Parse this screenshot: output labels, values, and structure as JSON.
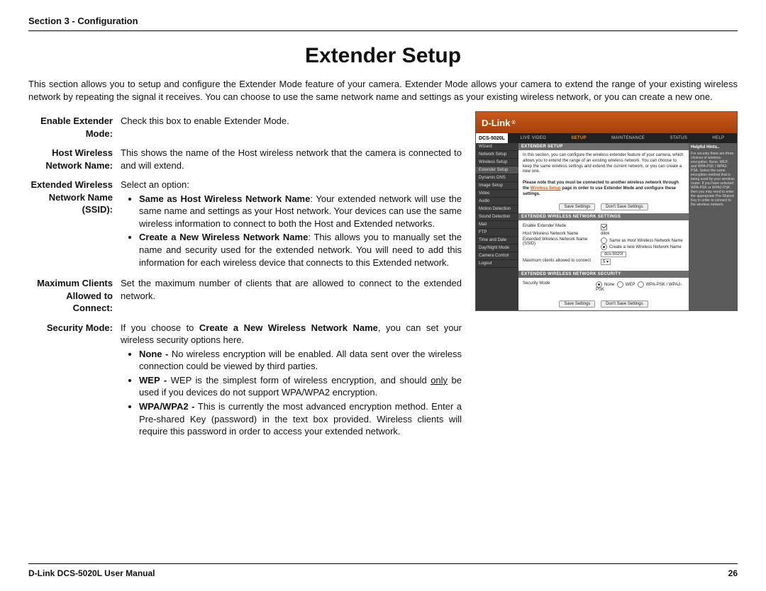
{
  "header": {
    "section_label": "Section 3 - Configuration"
  },
  "title": "Extender Setup",
  "intro": "This section allows you to setup and configure the Extender Mode feature of your camera. Extender Mode allows your camera to extend the range of your existing wireless network by repeating the signal it receives. You can choose to use the same network name and settings as your existing wireless network, or you can create a new one.",
  "defs": {
    "enable": {
      "label": "Enable Extender Mode:",
      "desc": "Check this box to enable Extender Mode."
    },
    "host": {
      "label": "Host Wireless Network Name:",
      "desc": "This shows the name of the Host wireless network that the camera is connected to and will extend."
    },
    "ssid": {
      "label": "Extended Wireless Network Name (SSID):",
      "lead": "Select an option:",
      "opt1_bold": "Same as Host Wireless Network Name",
      "opt1_rest": ": Your extended network will use the same name and settings as your Host network. Your devices can use the same wireless information to connect to both the Host and Extended networks.",
      "opt2_bold": "Create a New Wireless Network Name",
      "opt2_rest": ": This allows you to manually set the name and security used for the extended network. You will need to add this information for each wireless device that connects to this Extended network."
    },
    "max": {
      "label": "Maximum Clients Allowed to Connect:",
      "desc": "Set the maximum number of clients that are allowed to connect to the extended network."
    },
    "sec": {
      "label": "Security Mode:",
      "lead_pre": "If you choose to ",
      "lead_bold": "Create a New Wireless Network Name",
      "lead_post": ", you can set your wireless security options here.",
      "none_bold": "None - ",
      "none_rest": "No wireless encryption will be enabled. All data sent over the wireless connection could be viewed by third parties.",
      "wep_bold": "WEP - ",
      "wep_rest_pre": "WEP is the simplest form of wireless encryption, and should ",
      "wep_only": "only",
      "wep_rest_post": " be used if you devices do not support WPA/WPA2 encryption.",
      "wpa_bold": "WPA/WPA2 - ",
      "wpa_rest": "This is currently the most advanced encryption method. Enter a Pre-shared Key (password) in the text box provided. Wireless clients will require this password in order to access your extended network."
    }
  },
  "shot": {
    "brand": "D-Link",
    "model": "DCS-5020L",
    "tabs": [
      "LIVE VIDEO",
      "SETUP",
      "MAINTENANCE",
      "STATUS",
      "HELP"
    ],
    "tab_selected": "SETUP",
    "side": [
      "Wizard",
      "Network Setup",
      "Wireless Setup",
      "Extender Setup",
      "Dynamic DNS",
      "Image Setup",
      "Video",
      "Audio",
      "Motion Detection",
      "Sound Detection",
      "Mail",
      "FTP",
      "Time and Date",
      "Day/Night Mode",
      "Camera Control",
      "Logout"
    ],
    "side_selected": "Extender Setup",
    "panel_title": "EXTENDER SETUP",
    "panel_text": "In this section, you can configure the wireless extender feature of your camera, which allows you to extend the range of an existing wireless network. You can choose to keep the same wireless settings and extend the current network, or you can create a new one.",
    "panel_note_pre": "Please note that you must be connected to another wireless network through the ",
    "panel_note_link": "Wireless Setup",
    "panel_note_post": " page in order to use Extender Mode and configure these settings.",
    "btn_save": "Save Settings",
    "btn_cancel": "Don't Save Settings",
    "panel2_title": "EXTENDED WIRELESS NETWORK SETTINGS",
    "form": {
      "enable_label": "Enable Extender Mode",
      "host_label": "Host Wireless Network Name",
      "host_value": "dlink",
      "ssid_label": "Extended Wireless Network Name (SSID)",
      "ssid_opt1": "Same as Host Wireless Network Name",
      "ssid_opt2": "Create a new Wireless Network Name",
      "ssid_value": "dcs-5020l",
      "max_label": "Maximum clients allowed to connect",
      "max_value": "5 ▾"
    },
    "panel3_title": "EXTENDED WIRELESS NETWORK SECURITY",
    "sec_label": "Security Mode",
    "sec_opts": [
      "None",
      "WEP",
      "WPA-PSK / WPA2-PSK"
    ],
    "hints_title": "Helpful Hints..",
    "hints_body": "For security there are three choices of wireless encryption, None, WEP, and WPA-PSK / WPA2-PSK. Select the same encryption method that is being used by your wireless router. If you have selected WPA-PSK or WPA2-PSK then you may need to enter the appropriate Pre-Shared Key in order to connect to the wireless network."
  },
  "footer": {
    "manual": "D-Link DCS-5020L User Manual",
    "page": "26"
  }
}
